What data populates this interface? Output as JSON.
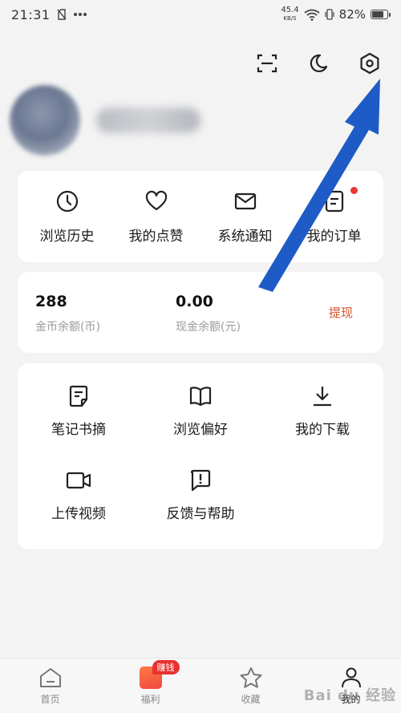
{
  "status_bar": {
    "time": "21:31",
    "net_speed_value": "45.4",
    "net_speed_unit": "KB/S",
    "battery_percent": "82%",
    "battery_level": 0.82
  },
  "top_actions": {
    "scan_icon": "scan-icon",
    "night_mode_icon": "moon-icon",
    "settings_icon": "settings-hexagon-icon"
  },
  "quick_actions": [
    {
      "label": "浏览历史",
      "icon": "clock-icon"
    },
    {
      "label": "我的点赞",
      "icon": "heart-icon"
    },
    {
      "label": "系统通知",
      "icon": "mail-icon"
    },
    {
      "label": "我的订单",
      "icon": "order-icon"
    }
  ],
  "balance": {
    "coins_value": "288",
    "coins_caption": "金币余额(币)",
    "cash_value": "0.00",
    "cash_caption": "现金余额(元)",
    "withdraw_label": "提现"
  },
  "tools": [
    {
      "label": "笔记书摘",
      "icon": "note-icon"
    },
    {
      "label": "浏览偏好",
      "icon": "book-icon"
    },
    {
      "label": "我的下载",
      "icon": "download-icon"
    },
    {
      "label": "上传视频",
      "icon": "video-camera-icon"
    },
    {
      "label": "反馈与帮助",
      "icon": "feedback-icon"
    }
  ],
  "bottom_nav": {
    "items": [
      {
        "label": "首页",
        "icon": "home-icon"
      },
      {
        "label": "福利",
        "icon": "welfare-icon",
        "badge": "赚钱"
      },
      {
        "label": "收藏",
        "icon": "star-icon"
      },
      {
        "label": "我的",
        "icon": "person-icon"
      }
    ]
  },
  "watermark": "Bai du 经验",
  "colors": {
    "accent_red": "#e53935",
    "withdraw_text": "#d9532c",
    "annotation_arrow": "#1e5bc6"
  }
}
